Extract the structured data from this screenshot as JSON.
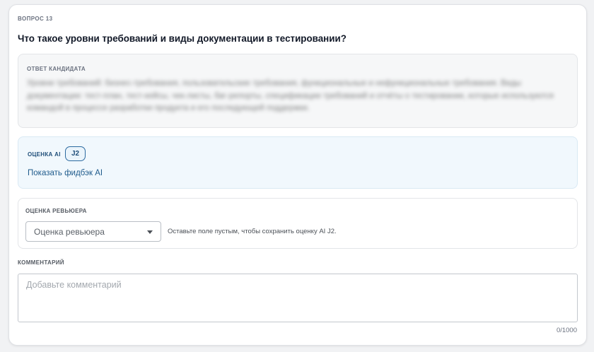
{
  "question": {
    "label": "ВОПРОС 13",
    "title": "Что такое уровни требований и виды документации в тестировании?"
  },
  "answer": {
    "label": "ОТВЕТ КАНДИДАТА",
    "text": "Уровни требований: бизнес-требования, пользовательские требования, функциональные и нефункциональные требования. Виды документации: тест-план, тест-кейсы, чек-листы, баг-репорты, спецификации требований и отчёты о тестировании, которые используются командой в процессе разработки продукта и его последующей поддержки."
  },
  "ai": {
    "label": "ОЦЕНКА AI",
    "badge": "J2",
    "link": "Показать фидбэк AI"
  },
  "review": {
    "label": "ОЦЕНКА РЕВЬЮЕРА",
    "select_value": "Оценка ревьюера",
    "hint": "Оставьте поле пустым, чтобы сохранить оценку AI J2."
  },
  "comment": {
    "label": "КОММЕНТАРИЙ",
    "placeholder": "Добавьте комментарий",
    "counter": "0/1000"
  },
  "colors": {
    "accent": "#1f5b8c",
    "ai_bg": "#f1f8fd",
    "answer_bg": "#f6f7f8"
  },
  "icons": {
    "select_caret": "caret-down-icon"
  }
}
